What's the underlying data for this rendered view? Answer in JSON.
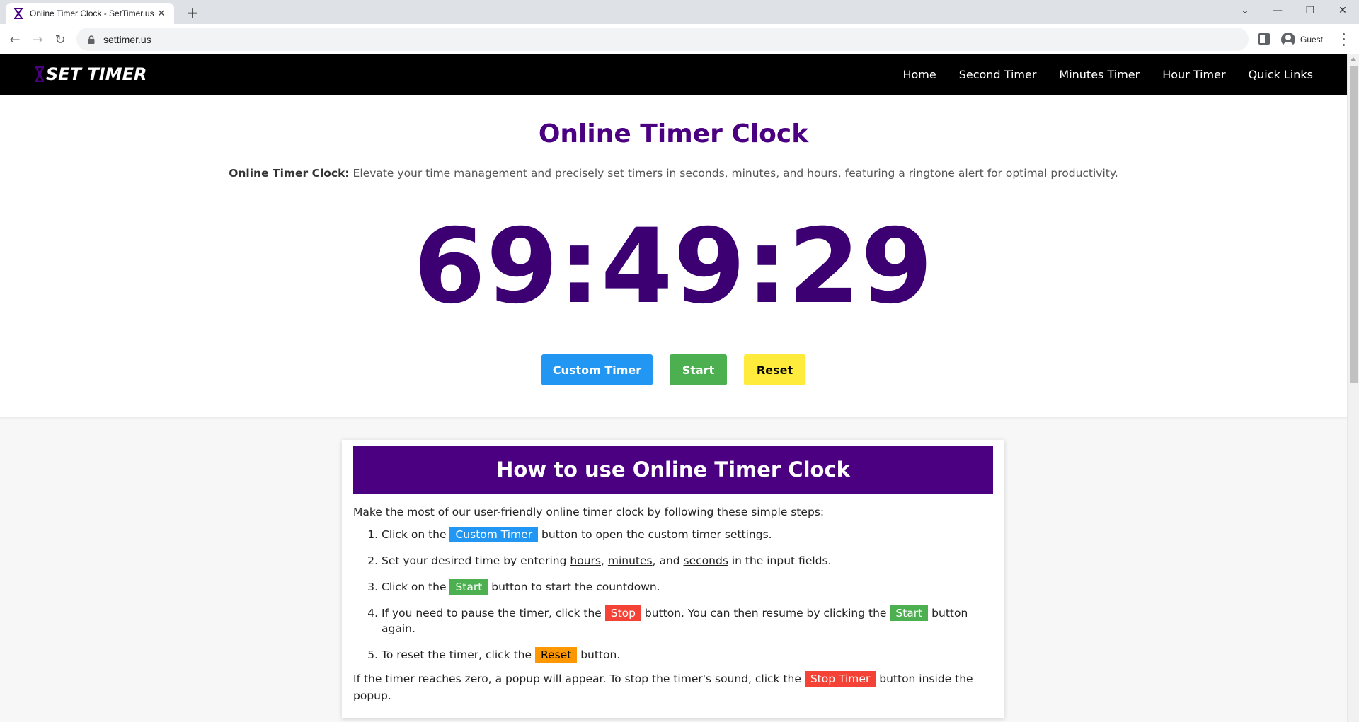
{
  "browser": {
    "tab_title": "Online Timer Clock - SetTimer.us",
    "tab_close": "✕",
    "new_tab": "+",
    "url": "settimer.us",
    "profile_label": "Guest",
    "window_controls": {
      "tabsearch": "⌄",
      "minimize": "—",
      "restore": "❐",
      "close": "✕"
    },
    "nav": {
      "back": "←",
      "forward": "→",
      "reload": "↻"
    }
  },
  "header": {
    "logo_text": "SET TIMER",
    "nav": [
      "Home",
      "Second Timer",
      "Minutes Timer",
      "Hour Timer",
      "Quick Links"
    ]
  },
  "hero": {
    "title": "Online Timer Clock",
    "desc_bold": "Online Timer Clock:",
    "desc_rest": " Elevate your time management and precisely set timers in seconds, minutes, and hours, featuring a ringtone alert for optimal productivity.",
    "clock": "69:49:29",
    "buttons": {
      "custom": "Custom Timer",
      "start": "Start",
      "reset": "Reset"
    }
  },
  "howto": {
    "title": "How to use Online Timer Clock",
    "intro": "Make the most of our user-friendly online timer clock by following these simple steps:",
    "step1": {
      "pre": "Click on the ",
      "tag": "Custom Timer",
      "post": " button to open the custom timer settings."
    },
    "step2": {
      "pre": "Set your desired time by entering ",
      "hours": "hours",
      "sep1": ", ",
      "minutes": "minutes",
      "sep2": ", and ",
      "seconds": "seconds",
      "post": " in the input fields."
    },
    "step3": {
      "pre": "Click on the ",
      "tag": "Start",
      "post": " button to start the countdown."
    },
    "step4": {
      "pre": "If you need to pause the timer, click the ",
      "tag_stop": "Stop",
      "mid": " button. You can then resume by clicking the ",
      "tag_start": "Start",
      "post": " button again."
    },
    "step5": {
      "pre": "To reset the timer, click the ",
      "tag": "Reset",
      "post": " button."
    },
    "outro": {
      "pre": "If the timer reaches zero, a popup will appear. To stop the timer's sound, click the ",
      "tag": "Stop Timer",
      "post": " button inside the popup."
    }
  },
  "colors": {
    "brand_purple": "#4b0082",
    "clock_purple": "#3d0073",
    "blue": "#2196f3",
    "green": "#4caf50",
    "yellow": "#ffeb3b",
    "red": "#f44336",
    "orange": "#ff9800"
  },
  "icons": [
    "hourglass-icon",
    "lock-icon",
    "side-panel-icon",
    "avatar-icon",
    "more-menu-icon"
  ]
}
